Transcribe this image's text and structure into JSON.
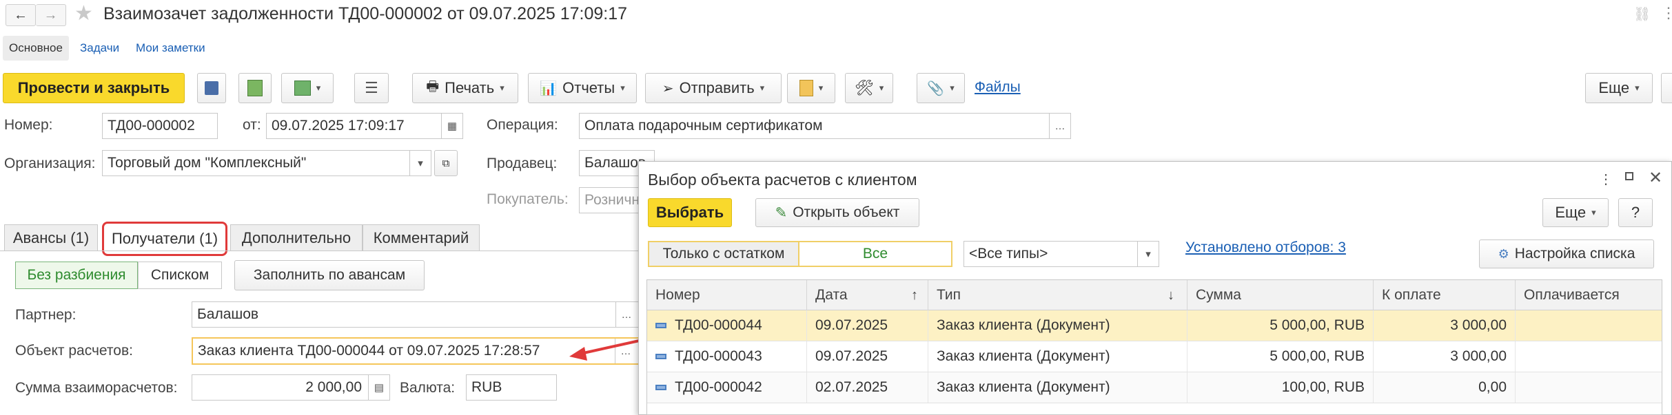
{
  "window": {
    "title": "Взаимозачет задолженности ТД00-000002 от 09.07.2025 17:09:17"
  },
  "top_tabs": [
    "Основное",
    "Задачи",
    "Мои заметки"
  ],
  "toolbar": {
    "post_close": "Провести и закрыть",
    "print": "Печать",
    "reports": "Отчеты",
    "send": "Отправить",
    "files": "Файлы",
    "more": "Еще"
  },
  "form": {
    "number_label": "Номер:",
    "number_value": "ТД00-000002",
    "from_label": "от:",
    "date_value": "09.07.2025 17:09:17",
    "operation_label": "Операция:",
    "operation_value": "Оплата подарочным сертификатом",
    "org_label": "Организация:",
    "org_value": "Торговый дом \"Комплексный\"",
    "seller_label": "Продавец:",
    "seller_value": "Балашов",
    "buyer_label": "Покупатель:",
    "buyer_value": "Розничн"
  },
  "tabs": [
    "Авансы (1)",
    "Получатели (1)",
    "Дополнительно",
    "Комментарий"
  ],
  "recipients": {
    "mode_no_split": "Без разбиения",
    "mode_list": "Списком",
    "fill_button": "Заполнить по авансам",
    "partner_label": "Партнер:",
    "partner_value": "Балашов",
    "object_label": "Объект расчетов:",
    "object_value": "Заказ клиента ТД00-000044 от 09.07.2025 17:28:57",
    "sum_label": "Сумма взаиморасчетов:",
    "sum_value": "2 000,00",
    "currency_label": "Валюта:",
    "currency_value": "RUB"
  },
  "dialog": {
    "title": "Выбор объекта расчетов с клиентом",
    "select_button": "Выбрать",
    "open_button": "Открыть объект",
    "more_button": "Еще",
    "help_button": "?",
    "filter_remaining": "Только с остатком",
    "filter_all": "Все",
    "types_value": "<Все типы>",
    "filters_link": "Установлено отборов: 3",
    "list_settings": "Настройка списка",
    "columns": [
      "Номер",
      "Дата",
      "Тип",
      "Сумма",
      "К оплате",
      "Оплачивается"
    ],
    "rows": [
      {
        "number": "ТД00-000044",
        "date": "09.07.2025",
        "type": "Заказ клиента (Документ)",
        "sum": "5 000,00, RUB",
        "to_pay": "3 000,00",
        "paying": ""
      },
      {
        "number": "ТД00-000043",
        "date": "09.07.2025",
        "type": "Заказ клиента (Документ)",
        "sum": "5 000,00, RUB",
        "to_pay": "3 000,00",
        "paying": ""
      },
      {
        "number": "ТД00-000042",
        "date": "02.07.2025",
        "type": "Заказ клиента (Документ)",
        "sum": "100,00, RUB",
        "to_pay": "0,00",
        "paying": ""
      }
    ]
  },
  "colors": {
    "accent_yellow": "#f9d92c",
    "selected_row": "#fdf1c4",
    "annotation_red": "#e03a3a",
    "link_blue": "#1a5fb4"
  }
}
